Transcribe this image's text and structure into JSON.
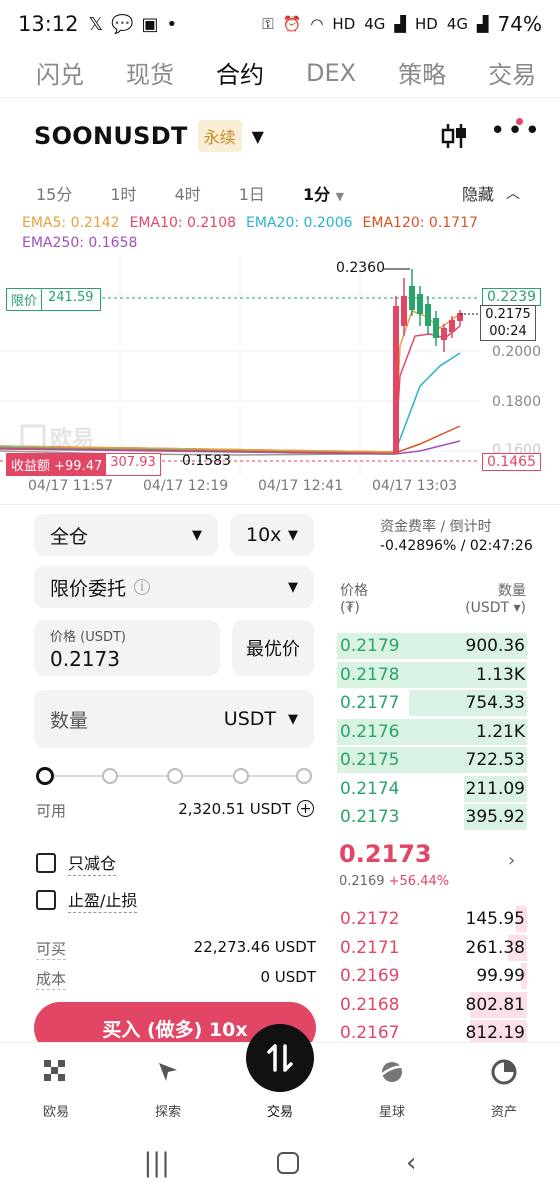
{
  "status": {
    "time": "13:12",
    "battery": "74%",
    "net1": "HD",
    "net2": "4G",
    "net3": "HD",
    "net4": "4G"
  },
  "top_tabs": [
    "闪兑",
    "现货",
    "合约",
    "DEX",
    "策略",
    "交易"
  ],
  "pair": {
    "symbol": "SOONUSDT",
    "badge": "永续"
  },
  "timeframes": [
    "15分",
    "1时",
    "4时",
    "1日",
    "1分"
  ],
  "hide_label": "隐藏",
  "ema": [
    {
      "label": "EMA5: 0.2142",
      "color": "#e6a23c"
    },
    {
      "label": "EMA10: 0.2108",
      "color": "#e14665"
    },
    {
      "label": "EMA20: 0.2006",
      "color": "#26b4cf"
    },
    {
      "label": "EMA120: 0.1717",
      "color": "#d9531e"
    },
    {
      "label": "EMA250: 0.1658",
      "color": "#a24fc2"
    }
  ],
  "chart_data": {
    "type": "line",
    "high_label": "0.2360",
    "low_label": "0.1583",
    "limit_label": "限价",
    "limit_value": "241.59",
    "pnl_label": "收益额 +99.47",
    "pnl_value": "307.93",
    "y_ticks": [
      "0.2239",
      "0.2000",
      "0.1800",
      "0.1600"
    ],
    "last_price": "0.2175",
    "countdown": "00:24",
    "right_low": "0.1465",
    "x_ticks": [
      "04/17 11:57",
      "04/17 12:19",
      "04/17 12:41",
      "04/17 13:03"
    ],
    "watermark": "欧易"
  },
  "order": {
    "margin_mode": "全仓",
    "leverage": "10x",
    "order_type": "限价委托",
    "price_label": "价格 (USDT)",
    "price_value": "0.2173",
    "best_price": "最优价",
    "qty_label": "数量",
    "qty_unit": "USDT",
    "available_label": "可用",
    "available_value": "2,320.51 USDT",
    "reduce_only": "只减仓",
    "tp_sl": "止盈/止损",
    "can_buy_label": "可买",
    "can_buy_value": "22,273.46 USDT",
    "cost_label": "成本",
    "cost_value": "0 USDT",
    "buy_button": "买入 (做多) 10x",
    "slider_value": 0
  },
  "funding": {
    "label": "资金费率 / 倒计时",
    "value": "-0.42896% / 02:47:26"
  },
  "orderbook": {
    "price_header": "价格",
    "price_unit": "(₮)",
    "qty_header": "数量",
    "qty_unit": "(USDT ▾)",
    "asks": [
      {
        "price": "0.2179",
        "qty": "900.36",
        "depth": 1.0
      },
      {
        "price": "0.2178",
        "qty": "1.13K",
        "depth": 1.0
      },
      {
        "price": "0.2177",
        "qty": "754.33",
        "depth": 0.62
      },
      {
        "price": "0.2176",
        "qty": "1.21K",
        "depth": 1.0
      },
      {
        "price": "0.2175",
        "qty": "722.53",
        "depth": 1.0
      },
      {
        "price": "0.2174",
        "qty": "211.09",
        "depth": 0.33
      },
      {
        "price": "0.2173",
        "qty": "395.92",
        "depth": 0.33
      }
    ],
    "last_price": "0.2173",
    "mark_price": "0.2169",
    "change": "+56.44%",
    "bids": [
      {
        "price": "0.2172",
        "qty": "145.95",
        "depth": 0.06
      },
      {
        "price": "0.2171",
        "qty": "261.38",
        "depth": 0.1
      },
      {
        "price": "0.2169",
        "qty": "99.99",
        "depth": 0.03
      },
      {
        "price": "0.2168",
        "qty": "802.81",
        "depth": 0.3
      },
      {
        "price": "0.2167",
        "qty": "812.19",
        "depth": 0.3
      }
    ]
  },
  "bottom_nav": [
    "欧易",
    "探索",
    "交易",
    "星球",
    "资产"
  ]
}
